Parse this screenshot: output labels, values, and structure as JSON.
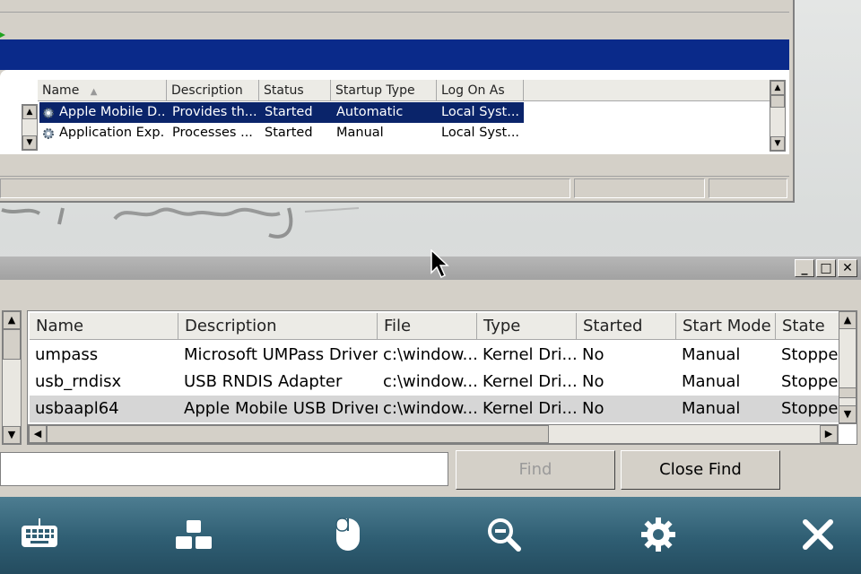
{
  "services": {
    "columns": [
      "Name",
      "Description",
      "Status",
      "Startup Type",
      "Log On As"
    ],
    "rows": [
      {
        "name": "Apple Mobile D...",
        "description": "Provides th...",
        "status": "Started",
        "startup": "Automatic",
        "logon": "Local Syst...",
        "selected": true
      },
      {
        "name": "Application Exp...",
        "description": "Processes ...",
        "status": "Started",
        "startup": "Manual",
        "logon": "Local Syst...",
        "selected": false
      }
    ],
    "sort_column": "Name",
    "sort_direction": "ascending"
  },
  "sysinfo": {
    "window_controls": {
      "minimize": "_",
      "maximize": "□",
      "close": "✕"
    },
    "columns": [
      "Name",
      "Description",
      "File",
      "Type",
      "Started",
      "Start Mode",
      "State"
    ],
    "rows": [
      {
        "name": "umpass",
        "description": "Microsoft UMPass Driver",
        "file": "c:\\window...",
        "type": "Kernel Dri...",
        "started": "No",
        "start_mode": "Manual",
        "state": "Stoppe"
      },
      {
        "name": "usb_rndisx",
        "description": "USB RNDIS Adapter",
        "file": "c:\\window...",
        "type": "Kernel Dri...",
        "started": "No",
        "start_mode": "Manual",
        "state": "Stoppe"
      },
      {
        "name": "usbaapl64",
        "description": "Apple Mobile USB Driver",
        "file": "c:\\window...",
        "type": "Kernel Dri...",
        "started": "No",
        "start_mode": "Manual",
        "state": "Stoppe",
        "highlight": true
      }
    ],
    "find": {
      "input_value": "",
      "find_label": "Find",
      "close_find_label": "Close Find"
    }
  },
  "remote_toolbar": {
    "buttons": [
      {
        "icon": "keyboard-icon"
      },
      {
        "icon": "apps-icon"
      },
      {
        "icon": "mouse-icon"
      },
      {
        "icon": "zoom-out-icon"
      },
      {
        "icon": "settings-gear-icon"
      },
      {
        "icon": "close-x-icon"
      }
    ]
  },
  "colors": {
    "selection": "#0a246a",
    "banner": "#0a2a8a",
    "toolbar_top": "#4d7d91",
    "toolbar_bottom": "#244c5f"
  }
}
